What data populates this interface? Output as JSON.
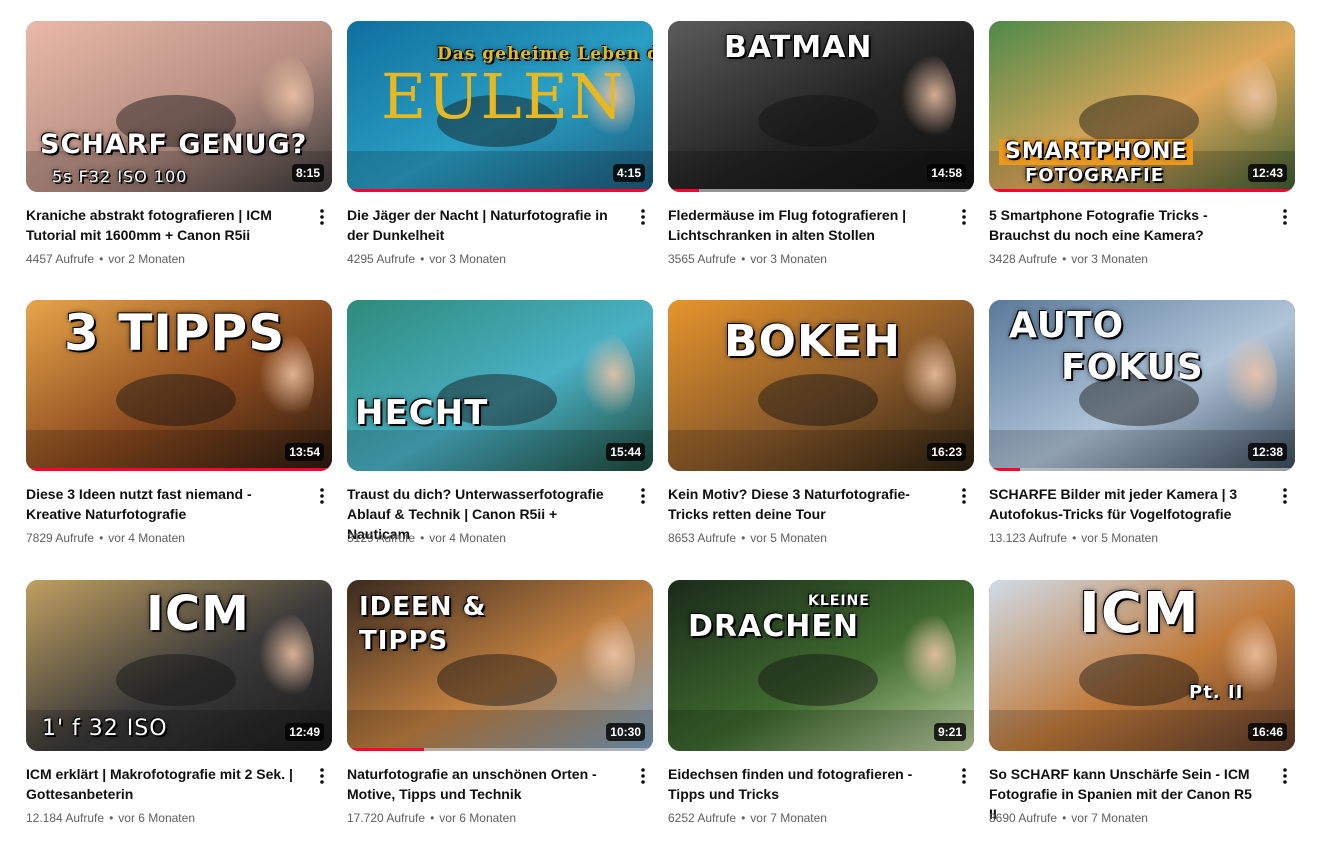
{
  "videos": [
    {
      "title": "Kraniche abstrakt fotografieren | ICM Tutorial mit 1600mm + Canon R5ii",
      "views": "4457 Aufrufe",
      "age": "vor 2 Monaten",
      "duration": "8:15",
      "overlay": "SCHARF GENUG?",
      "overlay2": "5s   F32   ISO 100",
      "progress": 0
    },
    {
      "title": "Die Jäger der Nacht | Naturfotografie in der Dunkelheit",
      "views": "4295 Aufrufe",
      "age": "vor 3 Monaten",
      "duration": "4:15",
      "overlay": "EULEN",
      "overlay2": "Das geheime Leben der",
      "progress": 1.0
    },
    {
      "title": "Fledermäuse im Flug fotografieren | Lichtschranken in alten Stollen",
      "views": "3565 Aufrufe",
      "age": "vor 3 Monaten",
      "duration": "14:58",
      "overlay": "BATMAN",
      "overlay2": "",
      "progress": 0.1
    },
    {
      "title": "5 Smartphone Fotografie Tricks - Brauchst du noch eine Kamera?",
      "views": "3428 Aufrufe",
      "age": "vor 3 Monaten",
      "duration": "12:43",
      "overlay": "SMARTPHONE",
      "overlay2": "FOTOGRAFIE",
      "progress": 1.0
    },
    {
      "title": "Diese 3 Ideen nutzt fast niemand - Kreative Naturfotografie",
      "views": "7829 Aufrufe",
      "age": "vor 4 Monaten",
      "duration": "13:54",
      "overlay": "3 TIPPS",
      "overlay2": "",
      "progress": 1.0
    },
    {
      "title": "Traust du dich? Unterwasserfotografie Ablauf & Technik | Canon R5ii + Nauticam",
      "views": "3129 Aufrufe",
      "age": "vor 4 Monaten",
      "duration": "15:44",
      "overlay": "HECHT",
      "overlay2": "",
      "progress": 0
    },
    {
      "title": "Kein Motiv? Diese 3 Naturfotografie-Tricks retten deine Tour",
      "views": "8653 Aufrufe",
      "age": "vor 5 Monaten",
      "duration": "16:23",
      "overlay": "BOKEH",
      "overlay2": "",
      "progress": 0
    },
    {
      "title": "SCHARFE Bilder mit jeder Kamera | 3 Autofokus-Tricks für Vogelfotografie",
      "views": "13.123 Aufrufe",
      "age": "vor 5 Monaten",
      "duration": "12:38",
      "overlay": "AUTO",
      "overlay2": "FOKUS",
      "progress": 0.1
    },
    {
      "title": "ICM erklärt | Makrofotografie mit 2 Sek. | Gottesanbeterin",
      "views": "12.184 Aufrufe",
      "age": "vor 6 Monaten",
      "duration": "12:49",
      "overlay": "ICM",
      "overlay2": "1'   f 32   ISO",
      "progress": 0
    },
    {
      "title": "Naturfotografie an unschönen Orten - Motive, Tipps und Technik",
      "views": "17.720 Aufrufe",
      "age": "vor 6 Monaten",
      "duration": "10:30",
      "overlay": "IDEEN &",
      "overlay2": "TIPPS",
      "progress": 0.25
    },
    {
      "title": "Eidechsen finden und fotografieren - Tipps und Tricks",
      "views": "6252 Aufrufe",
      "age": "vor 7 Monaten",
      "duration": "9:21",
      "overlay": "DRACHEN",
      "overlay2": "KLEINE",
      "progress": 0
    },
    {
      "title": "So SCHARF kann Unschärfe Sein - ICM Fotografie in Spanien mit der Canon R5 II",
      "views": "8690 Aufrufe",
      "age": "vor 7 Monaten",
      "duration": "16:46",
      "overlay": "ICM",
      "overlay2": "Pt. II",
      "progress": 0
    }
  ],
  "colors": {
    "progress": "#ff0033",
    "title": "#0f0f0f",
    "meta": "#606060"
  }
}
